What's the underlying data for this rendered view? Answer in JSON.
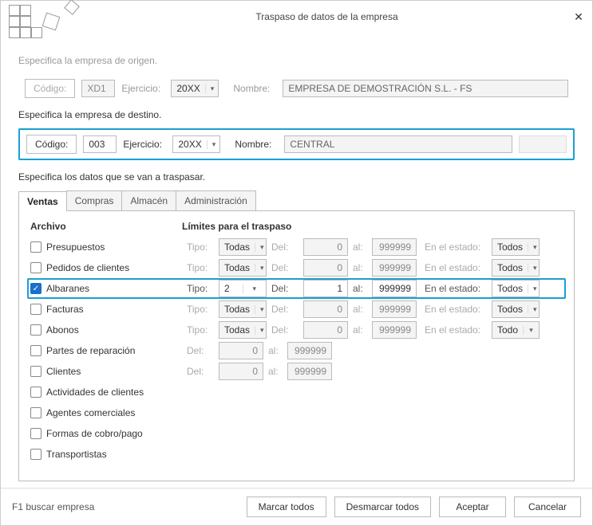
{
  "title": "Traspaso de datos de la empresa",
  "origin": {
    "label": "Especifica la empresa de origen.",
    "codigo_label": "Código:",
    "codigo": "XD1",
    "ejercicio_label": "Ejercicio:",
    "ejercicio": "20XX",
    "nombre_label": "Nombre:",
    "nombre": "EMPRESA DE DEMOSTRACIÓN S.L. - FS"
  },
  "dest": {
    "label": "Especifica la empresa de destino.",
    "codigo_label": "Código:",
    "codigo": "003",
    "ejercicio_label": "Ejercicio:",
    "ejercicio": "20XX",
    "nombre_label": "Nombre:",
    "nombre": "CENTRAL"
  },
  "transfer_label": "Especifica los datos que se van a traspasar.",
  "tabs": [
    "Ventas",
    "Compras",
    "Almacén",
    "Administración"
  ],
  "headers": {
    "archivo": "Archivo",
    "limites": "Límites para el traspaso"
  },
  "col": {
    "tipo": "Tipo:",
    "del": "Del:",
    "al": "al:",
    "estado": "En el estado:"
  },
  "rows": [
    {
      "label": "Presupuestos",
      "checked": false,
      "tipo": "Todas",
      "del": "0",
      "al": "999999",
      "estado": "Todos",
      "full": true
    },
    {
      "label": "Pedidos de clientes",
      "checked": false,
      "tipo": "Todas",
      "del": "0",
      "al": "999999",
      "estado": "Todos",
      "full": true
    },
    {
      "label": "Albaranes",
      "checked": true,
      "tipo": "2",
      "del": "1",
      "al": "999999",
      "estado": "Todos",
      "full": true,
      "active": true
    },
    {
      "label": "Facturas",
      "checked": false,
      "tipo": "Todas",
      "del": "0",
      "al": "999999",
      "estado": "Todos",
      "full": true
    },
    {
      "label": "Abonos",
      "checked": false,
      "tipo": "Todas",
      "del": "0",
      "al": "999999",
      "estado": "Todo",
      "full": true
    },
    {
      "label": "Partes de reparación",
      "checked": false,
      "del": "0",
      "al": "999999",
      "full": false
    },
    {
      "label": "Clientes",
      "checked": false,
      "del": "0",
      "al": "999999",
      "full": false
    },
    {
      "label": "Actividades de clientes",
      "checked": false
    },
    {
      "label": "Agentes comerciales",
      "checked": false
    },
    {
      "label": "Formas de cobro/pago",
      "checked": false
    },
    {
      "label": "Transportistas",
      "checked": false
    }
  ],
  "footer": {
    "hint": "F1 buscar empresa",
    "mark_all": "Marcar todos",
    "unmark_all": "Desmarcar todos",
    "accept": "Aceptar",
    "cancel": "Cancelar"
  }
}
